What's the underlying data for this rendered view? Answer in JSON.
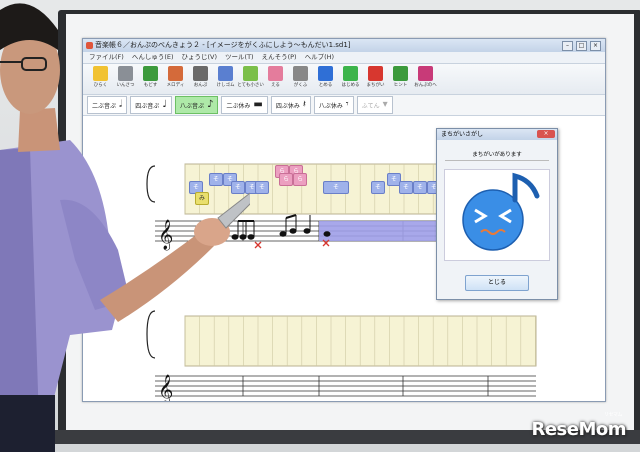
{
  "window": {
    "title": "音楽帳６／おんぷのべんきょう２ - [イメージをがくふにしよう～もんだい1.sd1]",
    "menus": [
      "ファイル(F)",
      "へんしゅう(E)",
      "ひょうじ(V)",
      "ツール(T)",
      "えんそう(P)",
      "ヘルプ(H)"
    ]
  },
  "toolbar": [
    {
      "label": "ひらく",
      "icon": "folder-icon",
      "color": "#f1c232"
    },
    {
      "label": "いんさつ",
      "icon": "printer-icon",
      "color": "#8a8f96"
    },
    {
      "label": "もどす",
      "icon": "undo-icon",
      "color": "#3c9a3c"
    },
    {
      "label": "メロディ",
      "icon": "pencil-icon",
      "color": "#d46a3a"
    },
    {
      "label": "おんぷ",
      "icon": "note-icon",
      "color": "#6a6a6a"
    },
    {
      "label": "けしゴム",
      "icon": "eraser-icon",
      "color": "#5a7fd0"
    },
    {
      "label": "とても小さい",
      "icon": "turtle-icon",
      "color": "#7bbf4a"
    },
    {
      "label": "える",
      "icon": "hand-icon",
      "color": "#e47c9c"
    },
    {
      "label": "がくふ",
      "icon": "score-icon",
      "color": "#888888"
    },
    {
      "label": "とめる",
      "icon": "stop-icon",
      "color": "#2f6fd6"
    },
    {
      "label": "はじめる",
      "icon": "play-icon",
      "color": "#3cb44b"
    },
    {
      "label": "まちがい",
      "icon": "check-icon",
      "color": "#d7372f"
    },
    {
      "label": "ヒント",
      "icon": "hint-icon",
      "color": "#3c9a3c"
    },
    {
      "label": "おんぷのへ",
      "icon": "notes-book-icon",
      "color": "#c83a78"
    }
  ],
  "note_buttons": [
    {
      "label": "二ぶ音ぷ",
      "glyph": "𝅗𝅥",
      "selected": false,
      "disabled": false
    },
    {
      "label": "四ぶ音ぷ",
      "glyph": "♩",
      "selected": false,
      "disabled": false
    },
    {
      "label": "八ぶ音ぷ",
      "glyph": "♪",
      "selected": true,
      "disabled": false
    },
    {
      "label": "二ぶ休み",
      "glyph": "▬",
      "selected": false,
      "disabled": false
    },
    {
      "label": "四ぶ休み",
      "glyph": "𝄽",
      "selected": false,
      "disabled": false
    },
    {
      "label": "八ぶ休み",
      "glyph": "𝄾",
      "selected": false,
      "disabled": false
    },
    {
      "label": "ふてん",
      "glyph": "▾",
      "selected": false,
      "disabled": true
    }
  ],
  "score": {
    "blocks": [
      "そ",
      "そ",
      "そ",
      "そ",
      "そ",
      "そ",
      "み",
      "ら",
      "ら",
      "ら",
      "ら",
      "そ",
      "そ",
      "そ",
      "そ",
      "そ",
      "そ"
    ]
  },
  "dialog": {
    "title": "まちがいさがし",
    "message": "まちがいがあります",
    "button": "とじる",
    "accent": "#3a8ee6"
  },
  "watermark": {
    "brand": "ReseMom",
    "ruby": "リセマム"
  }
}
